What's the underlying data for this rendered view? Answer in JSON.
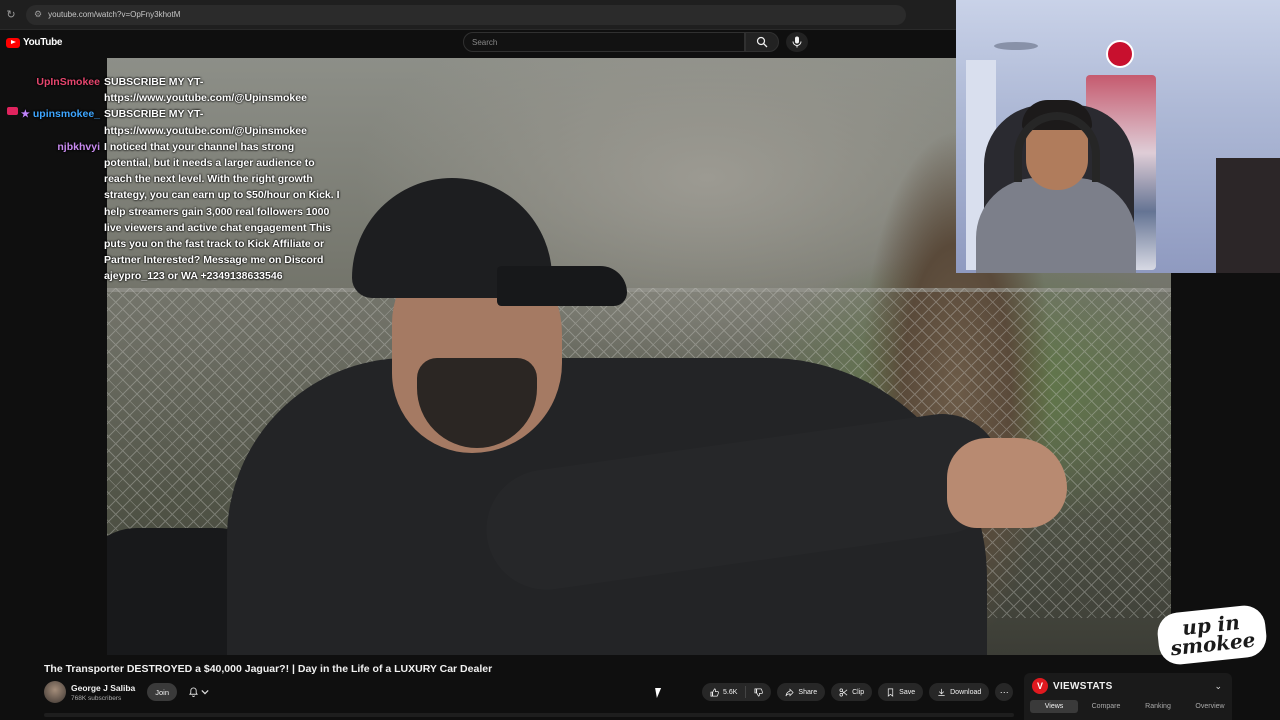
{
  "browser": {
    "url": "youtube.com/watch?v=OpFny3khotM"
  },
  "youtube": {
    "logo_text": "YouTube",
    "search_placeholder": "Search"
  },
  "chat": [
    {
      "user": "UpInSmokee",
      "user_color": "#e6466e",
      "badges": [],
      "text": "SUBSCRIBE MY YT-\nhttps://www.youtube.com/@Upinsmokee"
    },
    {
      "user": "upinsmokee_",
      "user_color": "#3ea6ff",
      "badges": [
        "camera-badge-icon",
        "star-badge-icon"
      ],
      "text": "SUBSCRIBE MY YT-\nhttps://www.youtube.com/@Upinsmokee"
    },
    {
      "user": "njbkhvyi",
      "user_color": "#c98bf0",
      "badges": [],
      "text": "I noticed that your channel has strong\npotential, but it needs a larger audience to\nreach the next level. With the right growth\nstrategy, you can earn up to $50/hour on Kick. I\nhelp streamers gain 3,000 real followers 1000\nlive viewers and active chat engagement This\nputs you on the fast track to Kick Affiliate or\nPartner Interested? Message me on Discord\najeypro_123 or WA +2349138633546"
    }
  ],
  "watermark": {
    "line1": "up in",
    "line2": "smokee"
  },
  "video": {
    "title": "The Transporter DESTROYED a $40,000 Jaguar?! | Day in the Life of a LUXURY Car Dealer",
    "channel_name": "George J Saliba",
    "subscribers": "768K subscribers",
    "join_label": "Join",
    "like_count": "5.6K",
    "share_label": "Share",
    "clip_label": "Clip",
    "save_label": "Save",
    "download_label": "Download"
  },
  "viewstats": {
    "logo_letter": "V",
    "title": "VIEWSTATS",
    "tabs": [
      "Views",
      "Compare",
      "Ranking",
      "Overview"
    ],
    "active_tab": "Views"
  },
  "colors": {
    "accent_red": "#ff0000",
    "viewstats_red": "#e0191f"
  }
}
